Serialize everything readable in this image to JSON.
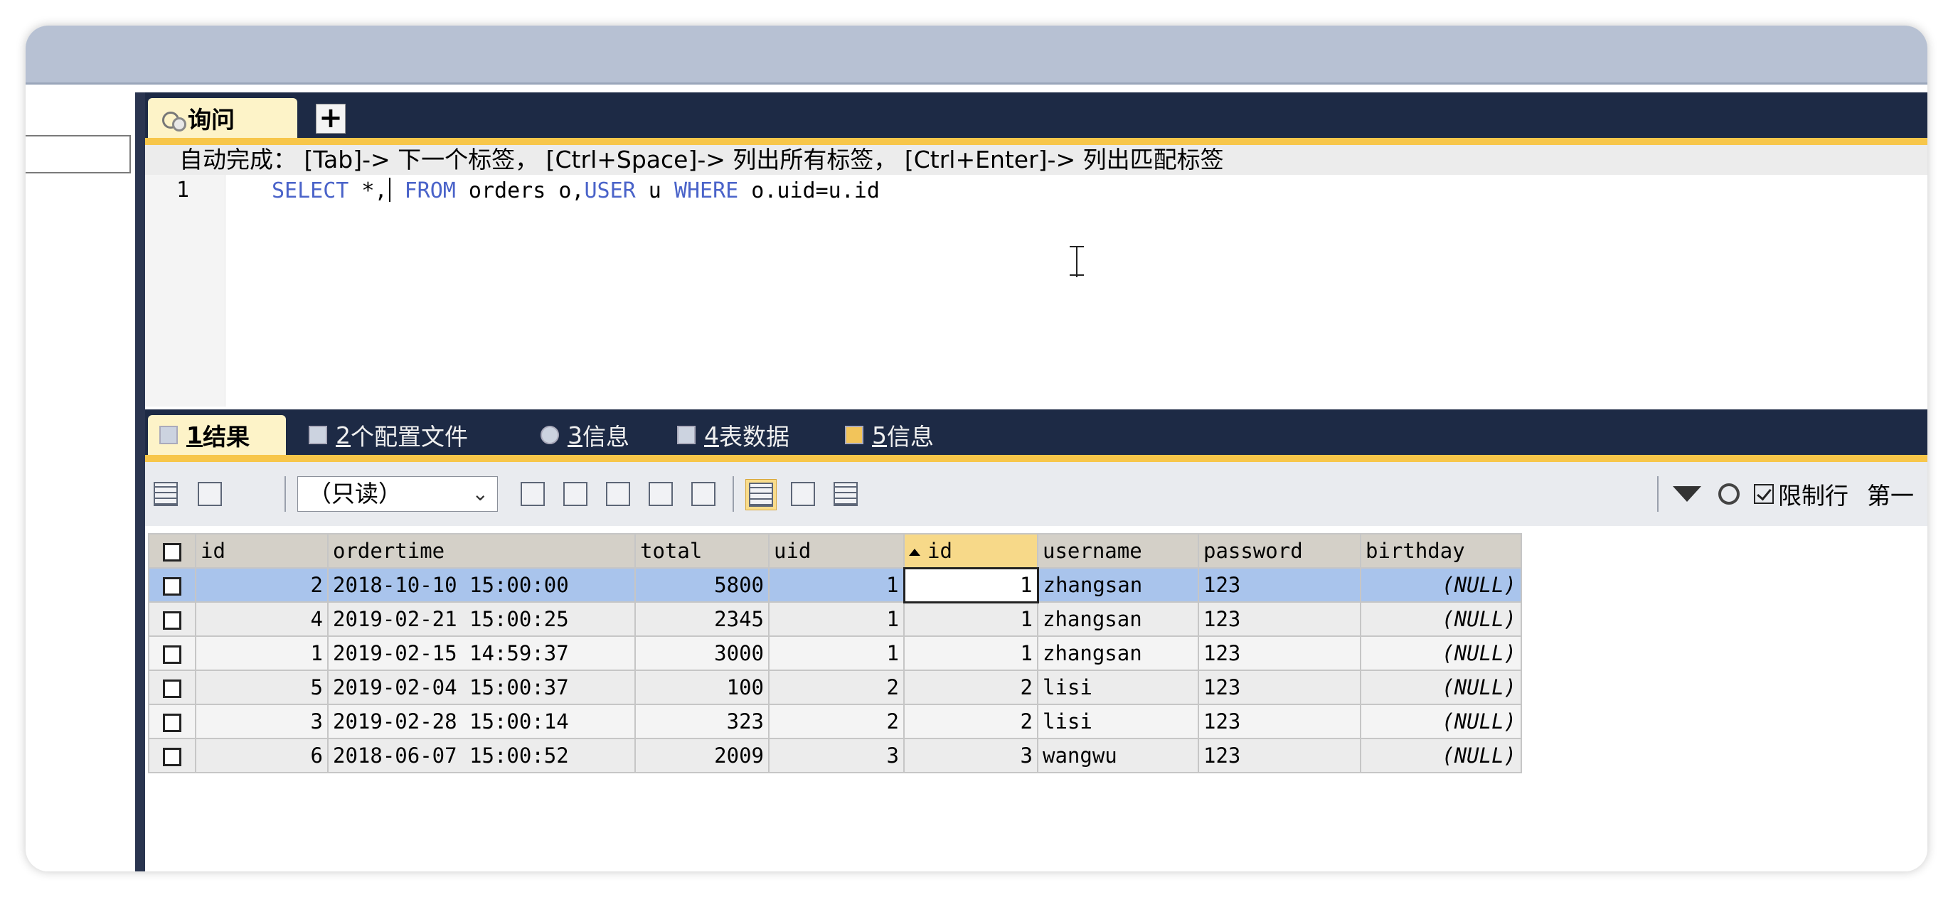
{
  "query_tab": {
    "label": "询问",
    "add_label": "+"
  },
  "autocomplete_hint": "自动完成： [Tab]-> 下一个标签， [Ctrl+Space]-> 列出所有标签， [Ctrl+Enter]-> 列出匹配标签",
  "editor": {
    "line_number": "1",
    "tokens": {
      "t1": "SELECT",
      "t2": " *,",
      "t3": " ",
      "t4": "FROM",
      "t5": " orders o,",
      "t6": "USER",
      "t7": " u ",
      "t8": "WHERE",
      "t9": " o.uid=u.id"
    }
  },
  "result_tabs": [
    {
      "num": "1",
      "label": " 结果"
    },
    {
      "num": "2",
      "label": " 个配置文件"
    },
    {
      "num": "3",
      "label": " 信息"
    },
    {
      "num": "4",
      "label": " 表数据"
    },
    {
      "num": "5",
      "label": " 信息"
    }
  ],
  "toolbar": {
    "mode_select": "（只读）",
    "limit_rows_label": "限制行",
    "first_label": "第一"
  },
  "grid": {
    "columns": [
      "id",
      "ordertime",
      "total",
      "uid",
      "id",
      "username",
      "password",
      "birthday"
    ],
    "rows": [
      [
        "2",
        "2018-10-10 15:00:00",
        "5800",
        "1",
        "1",
        "zhangsan",
        "123",
        "(NULL)"
      ],
      [
        "4",
        "2019-02-21 15:00:25",
        "2345",
        "1",
        "1",
        "zhangsan",
        "123",
        "(NULL)"
      ],
      [
        "1",
        "2019-02-15 14:59:37",
        "3000",
        "1",
        "1",
        "zhangsan",
        "123",
        "(NULL)"
      ],
      [
        "5",
        "2019-02-04 15:00:37",
        "100",
        "2",
        "2",
        "lisi",
        "123",
        "(NULL)"
      ],
      [
        "3",
        "2019-02-28 15:00:14",
        "323",
        "2",
        "2",
        "lisi",
        "123",
        "(NULL)"
      ],
      [
        "6",
        "2018-06-07 15:00:52",
        "2009",
        "3",
        "3",
        "wangwu",
        "123",
        "(NULL)"
      ]
    ]
  }
}
